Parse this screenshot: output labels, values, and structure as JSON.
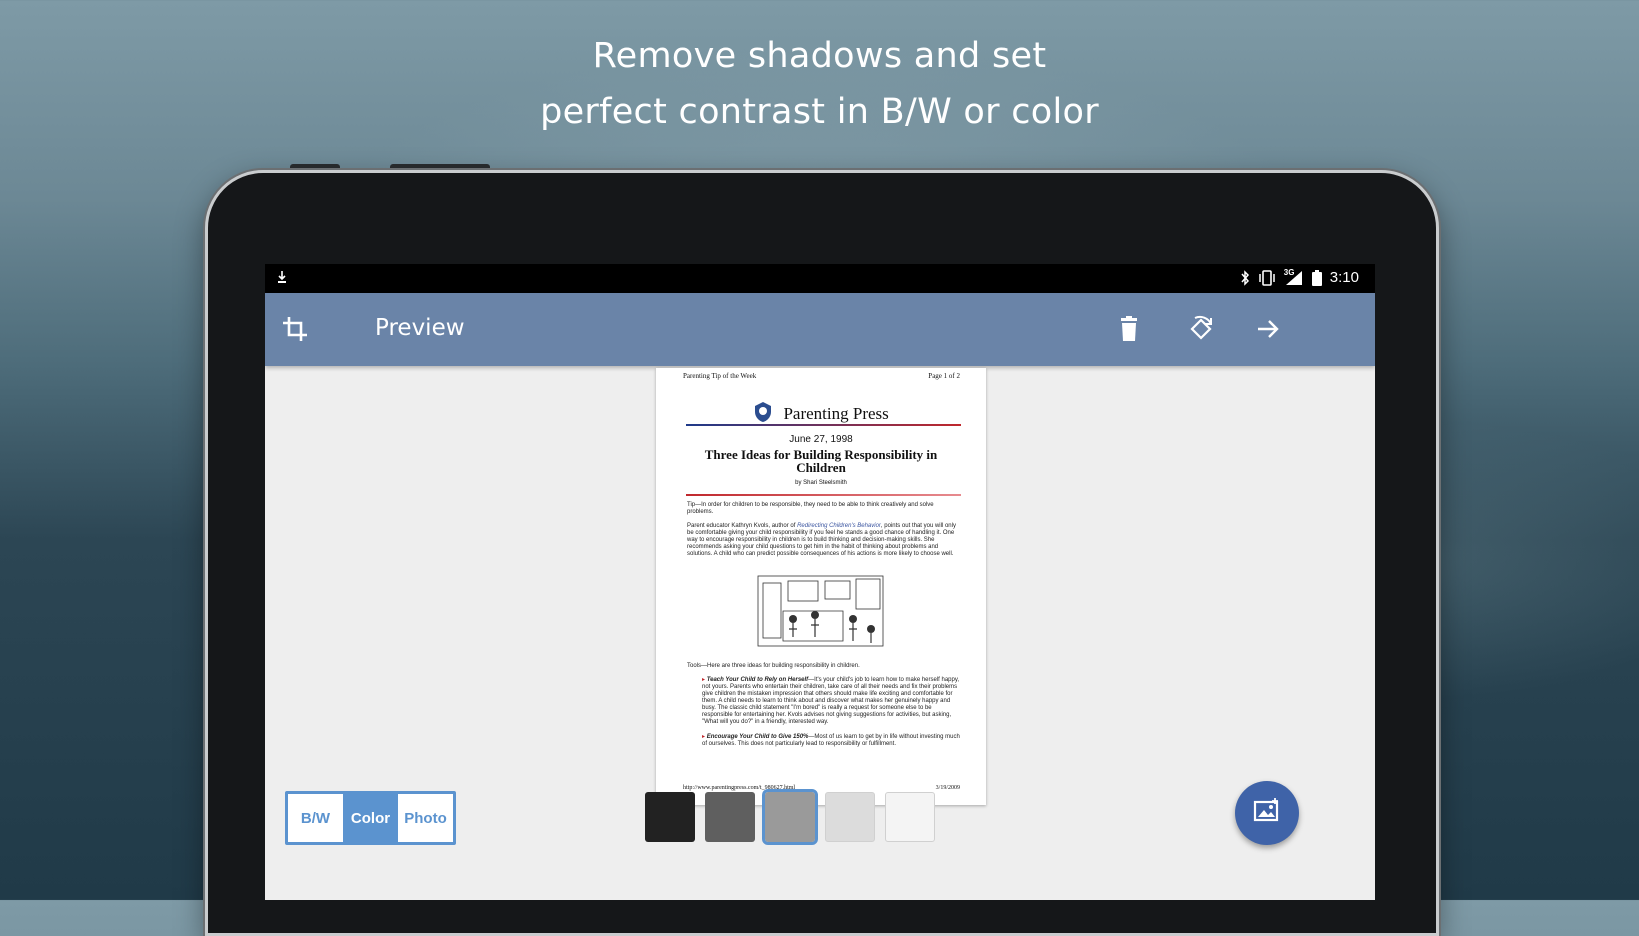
{
  "headline": {
    "line1": "Remove shadows and set",
    "line2": "perfect contrast in B/W or color"
  },
  "status_bar": {
    "time": "3:10",
    "network": "3G",
    "icons": [
      "download-icon",
      "bluetooth-icon",
      "vibrate-icon",
      "signal-icon",
      "battery-icon"
    ]
  },
  "toolbar": {
    "title": "Preview",
    "icons": [
      "crop-icon",
      "delete-icon",
      "rotate-icon",
      "arrow-forward-icon"
    ],
    "color": "#6a84a8"
  },
  "document": {
    "header_left": "Parenting Tip of the Week",
    "header_right": "Page 1 of 2",
    "logo_text": "Parenting Press",
    "date": "June 27, 1998",
    "title": "Three Ideas for Building Responsibility in Children",
    "byline": "by Shari Steelsmith",
    "tip_paragraph": "Tip—In order for children to be responsible, they need to be able to think creatively and solve problems.",
    "intro_paragraph_start": "Parent educator Kathryn Kvols, author of ",
    "intro_paragraph_book": "Redirecting Children's Behavior",
    "intro_paragraph_end": ", points out that you will only be comfortable giving your child responsibility if you feel he stands a good chance of handling it. One way to encourage responsibility in children is to build thinking and decision-making skills. She recommends asking your child questions to get him in the habit of thinking about problems and solutions. A child who can predict possible consequences of his actions is more likely to choose well.",
    "tools_paragraph": "Tools—Here are three ideas for building responsibility in children.",
    "bullet1_title": "Teach Your Child to Rely on Herself",
    "bullet1_text": "—It's your child's job to learn how to make herself happy, not yours. Parents who entertain their children, take care of all their needs and fix their problems give children the mistaken impression that others should make life exciting and comfortable for them. A child needs to learn to think about and discover what makes her genuinely happy and busy. The classic child statement \"I'm bored\" is really a request for someone else to be responsible for entertaining her. Kvols advises not giving suggestions for activities, but asking, \"What will you do?\" in a friendly, interested way.",
    "bullet2_title": "Encourage Your Child to Give 150%",
    "bullet2_text": "—Most of us learn to get by in life without investing much of ourselves. This does not particularly lead to responsibility or fulfillment.",
    "footer_left": "http://www.parentingpress.com/t_980627.html",
    "footer_right": "3/19/2009"
  },
  "modes": {
    "options": [
      "B/W",
      "Color",
      "Photo"
    ],
    "selected": "Color",
    "accent": "#5b93cf"
  },
  "swatches": {
    "colors": [
      "#222222",
      "#5f5f5f",
      "#9a9a9a",
      "#dcdcdc",
      "#f4f4f4"
    ],
    "selected_index": 2
  },
  "fab": {
    "icon": "image-icon",
    "color": "#3f63a8"
  }
}
